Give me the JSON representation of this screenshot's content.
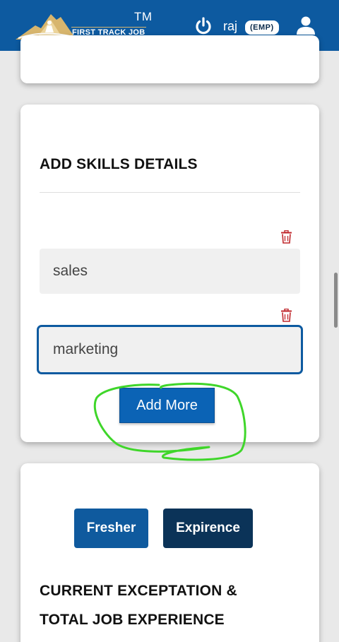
{
  "header": {
    "logo_text": "FIRST TRACK JOB",
    "trademark": "TM",
    "username": "raj",
    "role_badge": "(EMP)",
    "power_icon": "power-icon",
    "user_icon": "user-icon"
  },
  "skills_section": {
    "title": "ADD SKILLS DETAILS",
    "skills": [
      {
        "value": "sales"
      },
      {
        "value": "marketing"
      }
    ],
    "delete_icon": "trash-icon",
    "add_more_label": "Add More"
  },
  "experience_section": {
    "fresher_label": "Fresher",
    "experience_label": "Expirence",
    "title_line1": "CURRENT EXCEPTATION &",
    "title_line2": "TOTAL JOB EXPERIENCE"
  },
  "colors": {
    "header_bg": "#0d5aa0",
    "primary_button": "#0b63b5",
    "dark_button": "#0b3358",
    "delete_red": "#c0282d",
    "annotation_green": "#3fd62a"
  }
}
